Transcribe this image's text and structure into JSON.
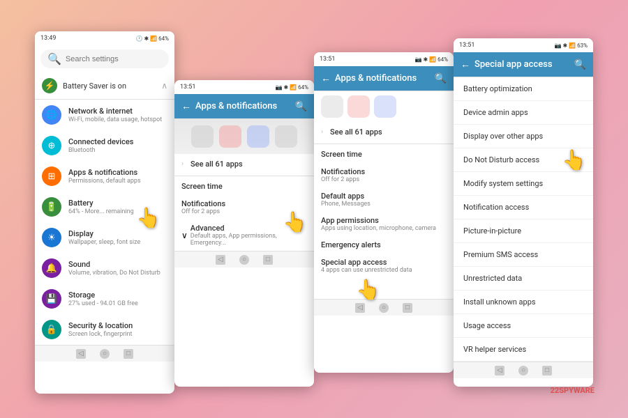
{
  "screen1": {
    "status": {
      "time": "13:49",
      "battery": "64%"
    },
    "search_placeholder": "Search settings",
    "battery_banner": "Battery Saver is on",
    "items": [
      {
        "label": "Network & internet",
        "sub": "Wi-Fi, mobile, data usage, hotspot",
        "icon": "🌐",
        "color": "icon-blue"
      },
      {
        "label": "Connected devices",
        "sub": "Bluetooth",
        "icon": "💠",
        "color": "icon-teal"
      },
      {
        "label": "Apps & notifications",
        "sub": "Permissions, default apps",
        "icon": "⊞",
        "color": "icon-orange"
      },
      {
        "label": "Battery",
        "sub": "64% - More... remaining",
        "icon": "🔋",
        "color": "icon-green-dark"
      },
      {
        "label": "Display",
        "sub": "Wallpaper, sleep, font size",
        "icon": "☀",
        "color": "icon-blue2"
      },
      {
        "label": "Sound",
        "sub": "Volume, vibration, Do Not Disturb",
        "icon": "🔔",
        "color": "icon-purple"
      },
      {
        "label": "Storage",
        "sub": "27% used - 94.01 GB free",
        "icon": "💾",
        "color": "icon-purple"
      },
      {
        "label": "Security & location",
        "sub": "Screen lock, fingerprint",
        "icon": "🔒",
        "color": "icon-teal2"
      }
    ]
  },
  "screen2": {
    "status": {
      "time": "13:51",
      "battery": "64%"
    },
    "title": "Apps & notifications",
    "see_all": "See all 61 apps",
    "sections": [
      {
        "label": "Screen time"
      },
      {
        "label": "Notifications",
        "sub": "Off for 2 apps"
      },
      {
        "label": "Advanced",
        "sub": "Default apps, App permissions, Emergency...",
        "expanded": true
      }
    ]
  },
  "screen3": {
    "status": {
      "time": "13:51",
      "battery": "64%"
    },
    "title": "Apps & notifications",
    "see_all": "See all 61 apps",
    "items": [
      {
        "label": "Screen time"
      },
      {
        "label": "Notifications",
        "sub": "Off for 2 apps"
      },
      {
        "label": "Default apps",
        "sub": "Phone, Messages"
      },
      {
        "label": "App permissions",
        "sub": "Apps using location, microphone, camera"
      },
      {
        "label": "Emergency alerts"
      },
      {
        "label": "Special app access",
        "sub": "4 apps can use unrestricted data"
      }
    ]
  },
  "screen4": {
    "status": {
      "time": "13:51",
      "battery": "63%"
    },
    "title": "Special app access",
    "items": [
      "Battery optimization",
      "Device admin apps",
      "Display over other apps",
      "Do Not Disturb access",
      "Modify system settings",
      "Notification access",
      "Picture-in-picture",
      "Premium SMS access",
      "Unrestricted data",
      "Install unknown apps",
      "Usage access",
      "VR helper services"
    ]
  },
  "watermark": "2SPYWARE",
  "icons": {
    "back": "←",
    "search": "🔍",
    "chevron_right": "›",
    "chevron_down": "∨",
    "nav_back": "◁",
    "nav_home": "○",
    "nav_recent": "□"
  }
}
